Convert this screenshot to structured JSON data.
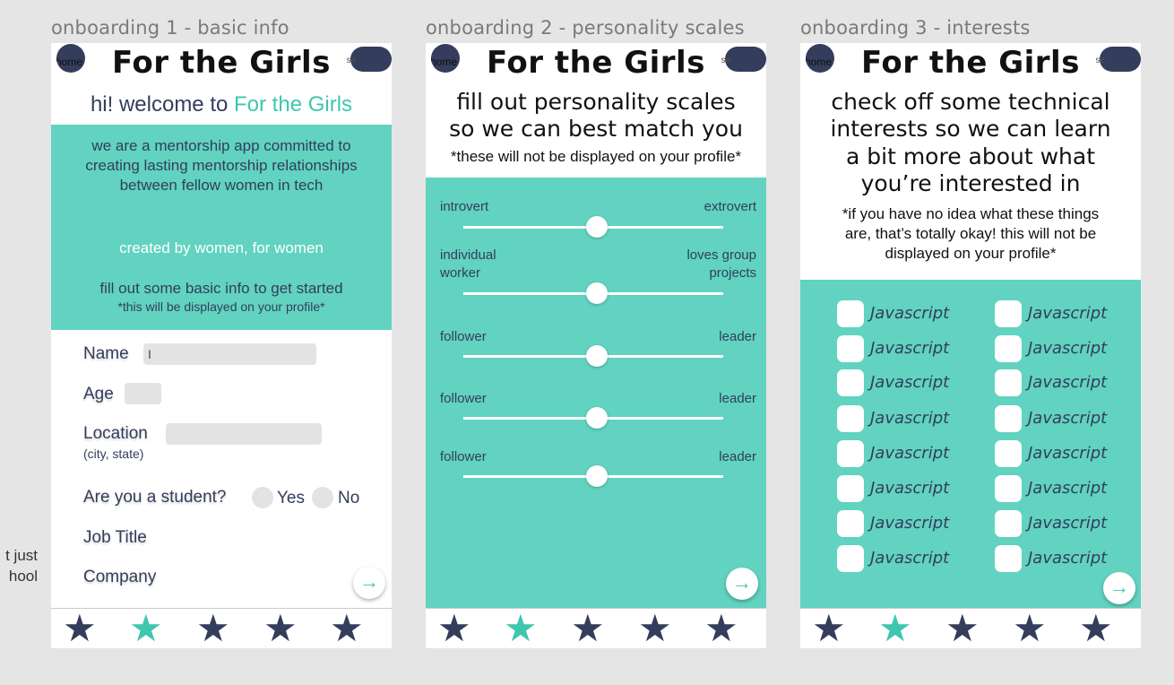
{
  "frames": [
    {
      "label": "onboarding 1 - basic info"
    },
    {
      "label": "onboarding 2 - personality scales"
    },
    {
      "label": "onboarding 3 - interests"
    }
  ],
  "side_note": {
    "line1": "t just",
    "line2": "hool"
  },
  "header": {
    "title": "For the Girls",
    "home_label": "home",
    "settings_label": "se"
  },
  "screen1": {
    "welcome_prefix": "hi! welcome to ",
    "welcome_brand": "For the Girls",
    "intro": "we are a mentorship app committed to creating lasting mentorship relationships between fellow women in tech",
    "tagline": "created by women, for women",
    "cta": "fill out some basic info to get started",
    "note": "*this will be displayed on your profile*",
    "name_label": "Name",
    "name_value": "I",
    "age_label": "Age",
    "location_label": "Location",
    "location_hint": "(city, state)",
    "student_label": "Are you a student?",
    "yes_label": "Yes",
    "no_label": "No",
    "job_label": "Job Title",
    "company_label": "Company",
    "next_icon": "arrow-right"
  },
  "screen2": {
    "heading_line1": "fill out personality scales",
    "heading_line2": "so we can best match you",
    "note": "*these will not be displayed on your profile*",
    "scales": [
      {
        "left": "introvert",
        "right": "extrovert",
        "value": 0.5
      },
      {
        "left": "individual worker",
        "right": "loves group projects",
        "value": 0.5
      },
      {
        "left": "follower",
        "right": "leader",
        "value": 0.5
      },
      {
        "left": "follower",
        "right": "leader",
        "value": 0.5
      },
      {
        "left": "follower",
        "right": "leader",
        "value": 0.5
      }
    ]
  },
  "screen3": {
    "heading_line1": "check off some technical",
    "heading_line2": "interests so we can learn",
    "heading_line3": "a bit more about what",
    "heading_line4": "you’re interested in",
    "note_line1": "*if you have no idea what these things",
    "note_line2": "are, that’s totally okay! this will not be",
    "note_line3": "displayed on your profile*",
    "interests": [
      "Javascript",
      "Javascript",
      "Javascript",
      "Javascript",
      "Javascript",
      "Javascript",
      "Javascript",
      "Javascript",
      "Javascript",
      "Javascript",
      "Javascript",
      "Javascript",
      "Javascript",
      "Javascript",
      "Javascript",
      "Javascript"
    ]
  },
  "progress": {
    "total_steps": 5,
    "active_step": 2,
    "star_glyph": "★"
  },
  "colors": {
    "teal": "#61d3c0",
    "accent": "#3fc6ae",
    "navy": "#343d5c",
    "field": "#e3e3e3"
  }
}
